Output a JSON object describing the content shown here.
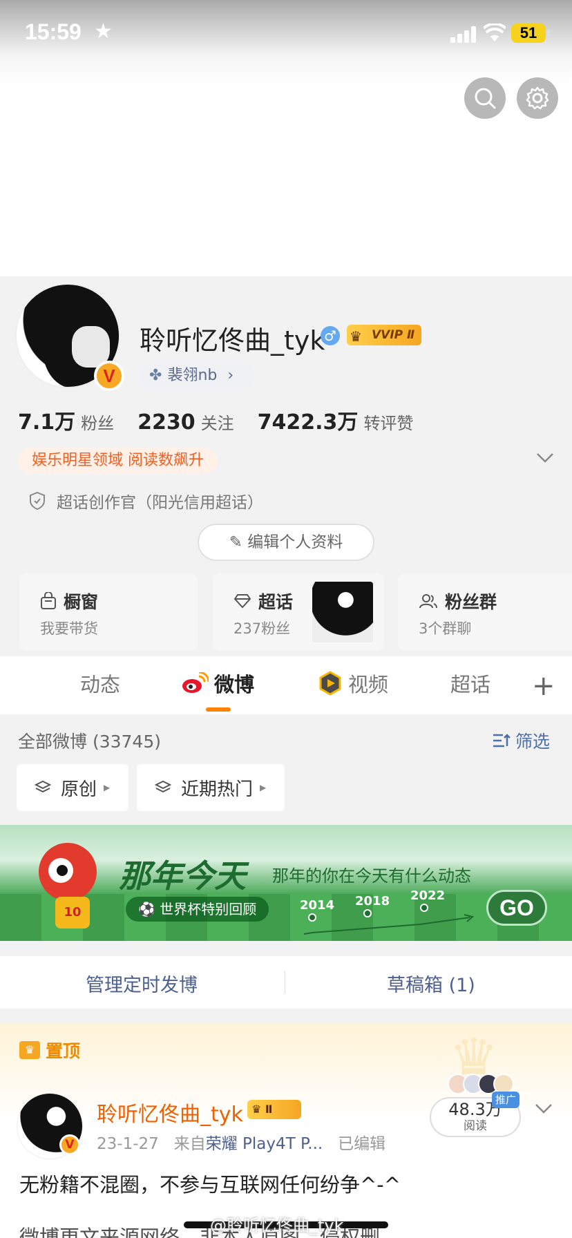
{
  "status_bar": {
    "time": "15:59",
    "battery": "51"
  },
  "profile": {
    "username": "聆听忆佟曲_tyk",
    "gender_symbol": "♂",
    "vip_label": "VVIP Ⅱ",
    "verified_badge": "V",
    "tag": "裴翎nb",
    "stats": [
      {
        "value": "7.1万",
        "label": "粉丝"
      },
      {
        "value": "2230",
        "label": "关注"
      },
      {
        "value": "7422.3万",
        "label": "转评赞"
      }
    ],
    "promo": "娱乐明星领域 阅读数飙升",
    "creator": "超话创作官（阳光信用超话）",
    "edit_button": "编辑个人资料"
  },
  "cards": [
    {
      "title": "橱窗",
      "subtitle": "我要带货"
    },
    {
      "title": "超话",
      "subtitle": "237粉丝"
    },
    {
      "title": "粉丝群",
      "subtitle": "3个群聊"
    }
  ],
  "tabs": [
    {
      "label": "动态"
    },
    {
      "label": "微博"
    },
    {
      "label": "视频"
    },
    {
      "label": "超话"
    }
  ],
  "filter": {
    "all_posts": "全部微博 (33745)",
    "filter_label": "筛选",
    "chips": [
      "原创",
      "近期热门"
    ]
  },
  "banner": {
    "title": "那年今天",
    "subtitle": "那年的你在今天有什么动态",
    "pill": "⚽ 世界杯特别回顾",
    "jersey": "10",
    "years": [
      "2014",
      "2018",
      "2022"
    ],
    "go": "GO"
  },
  "manage": {
    "scheduled": "管理定时发博",
    "drafts": "草稿箱 (1)"
  },
  "post": {
    "pinned": "置顶",
    "author": "聆听忆佟曲_tyk",
    "author_badge": "Ⅱ",
    "date": "23-1-27",
    "from": "来自",
    "source": "荣耀 Play4T P...",
    "edited": "已编辑",
    "reads_value": "48.3万",
    "reads_label": "阅读",
    "promo_tag": "推广",
    "text": "无粉籍不混圈，不参与互联网任何纷争^-^",
    "text2": "微博更文来源网络，非本人原图，侵权删",
    "watermark": "@聆听忆佟曲_tyk"
  },
  "colors": {
    "accent": "#ff8200",
    "link": "#4d6090",
    "promo": "#f25f22"
  }
}
